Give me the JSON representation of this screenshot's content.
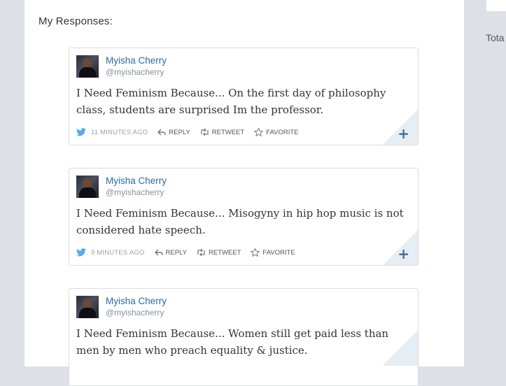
{
  "section_label": "My Responses:",
  "sidebar": {
    "total_label": "Tota"
  },
  "actions": {
    "reply": "REPLY",
    "retweet": "RETWEET",
    "favorite": "FAVORITE",
    "expand": "+"
  },
  "tweets": [
    {
      "author": "Myisha Cherry",
      "handle": "@myishacherry",
      "text": "I Need Feminism Because... On the first day of philosophy class, students are surprised Im the professor.",
      "time": "11 MINUTES AGO"
    },
    {
      "author": "Myisha Cherry",
      "handle": "@myishacherry",
      "text": "I Need Feminism Because... Misogyny in hip hop music is not considered hate speech.",
      "time": "9 MINUTES AGO"
    },
    {
      "author": "Myisha Cherry",
      "handle": "@myishacherry",
      "text": "I Need Feminism Because... Women still get paid less than men by men who preach equality & justice.",
      "time": ""
    }
  ],
  "colors": {
    "link": "#2b6aa6",
    "accent": "#3f6f96",
    "twitter_bird": "#55acee"
  }
}
